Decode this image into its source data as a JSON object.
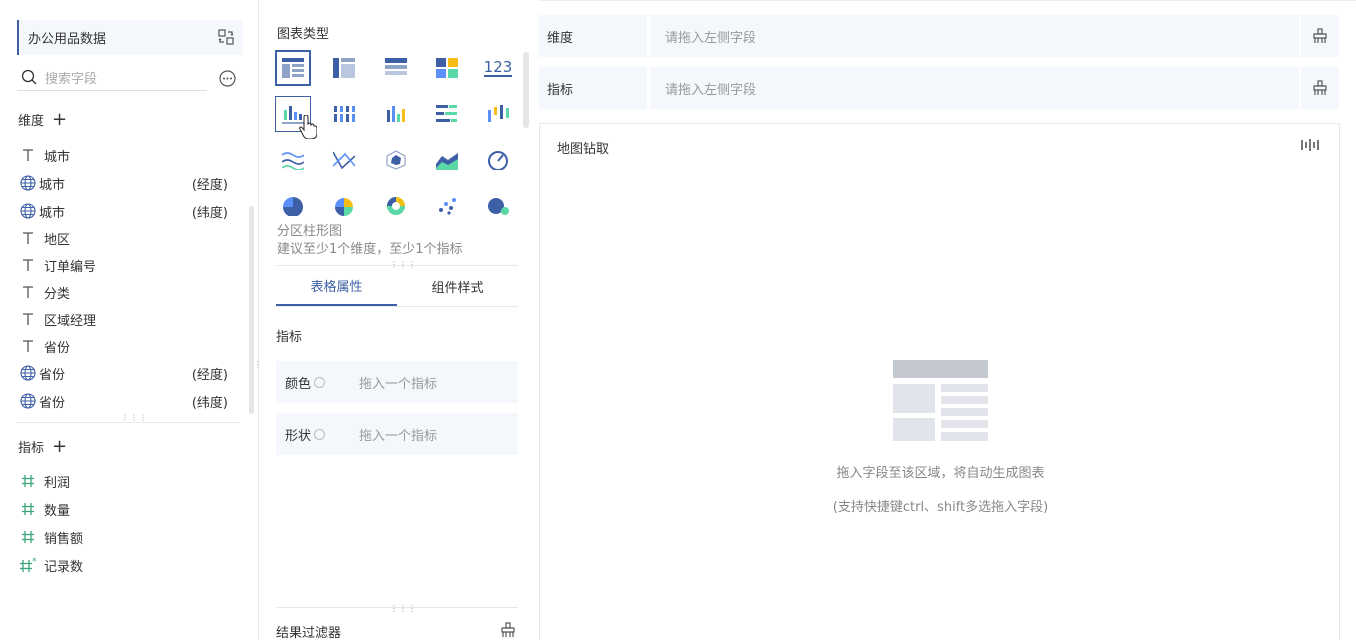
{
  "dataset": {
    "name": "办公用品数据",
    "switch_icon": "swap-icon"
  },
  "search": {
    "placeholder": "搜索字段",
    "more_icon": "more-icon"
  },
  "dimensions": {
    "label": "维度",
    "items": [
      {
        "icon": "text",
        "name": "城市",
        "sub": ""
      },
      {
        "icon": "globe",
        "name": "城市",
        "sub": "(经度)"
      },
      {
        "icon": "globe",
        "name": "城市",
        "sub": "(纬度)"
      },
      {
        "icon": "text",
        "name": "地区",
        "sub": ""
      },
      {
        "icon": "text",
        "name": "订单编号",
        "sub": ""
      },
      {
        "icon": "text",
        "name": "分类",
        "sub": ""
      },
      {
        "icon": "text",
        "name": "区域经理",
        "sub": ""
      },
      {
        "icon": "text",
        "name": "省份",
        "sub": ""
      },
      {
        "icon": "globe",
        "name": "省份",
        "sub": "(经度)"
      },
      {
        "icon": "globe",
        "name": "省份",
        "sub": "(纬度)"
      }
    ]
  },
  "measures": {
    "label": "指标",
    "items": [
      {
        "icon": "hash",
        "name": "利润"
      },
      {
        "icon": "hash",
        "name": "数量"
      },
      {
        "icon": "hash",
        "name": "销售额"
      },
      {
        "icon": "hash-star",
        "name": "记录数"
      }
    ]
  },
  "chart_types": {
    "label": "图表类型",
    "selected_name": "分区柱形图",
    "selected_hint": "建议至少1个维度，至少1个指标",
    "number_icon_text": "123"
  },
  "tabs": [
    {
      "label": "表格属性",
      "active": true
    },
    {
      "label": "组件样式",
      "active": false
    }
  ],
  "props": {
    "section": "指标",
    "color_label": "颜色",
    "shape_label": "形状",
    "drop_hint": "拖入一个指标"
  },
  "filter": {
    "label": "结果过滤器"
  },
  "shelves": {
    "dimension_label": "维度",
    "measure_label": "指标",
    "placeholder": "请拖入左侧字段"
  },
  "canvas": {
    "title": "地图钻取",
    "hint": "拖入字段至该区域，将自动生成图表",
    "hint2": "(支持快捷键ctrl、shift多选拖入字段)"
  },
  "colors": {
    "accent": "#3d5fa6",
    "panel": "#f4f7fb",
    "blue": "#5b8ff9",
    "teal": "#5ad8a6",
    "orange": "#f6bd16",
    "green": "#3aa57a"
  }
}
